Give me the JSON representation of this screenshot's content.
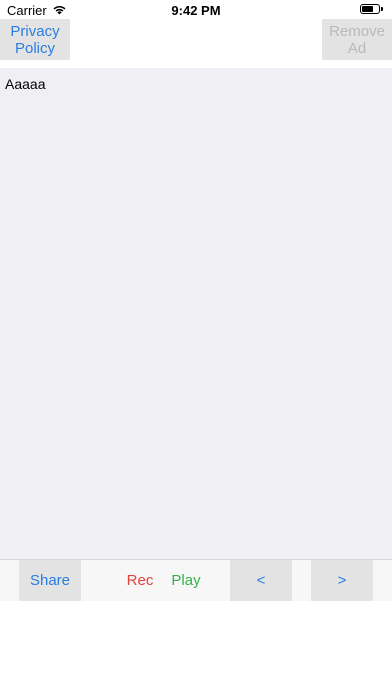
{
  "status_bar": {
    "carrier": "Carrier",
    "time": "9:42 PM",
    "battery_level": 0.7,
    "icons": [
      "wifi-icon",
      "battery-icon"
    ]
  },
  "header": {
    "privacy_label_line1": "Privacy",
    "privacy_label_line2": "Policy",
    "remove_ad_line1": "Remove",
    "remove_ad_line2": "Ad"
  },
  "editor": {
    "text": "Aaaaa"
  },
  "toolbar": {
    "share_label": "Share",
    "rec_label": "Rec",
    "play_label": "Play",
    "prev_label": "<",
    "next_label": ">"
  },
  "colors": {
    "accent_blue": "#2b7de0",
    "rec_red": "#e0413a",
    "play_green": "#35b04a",
    "disabled_gray": "#b9b9b9",
    "editor_bg": "#efeff4"
  }
}
